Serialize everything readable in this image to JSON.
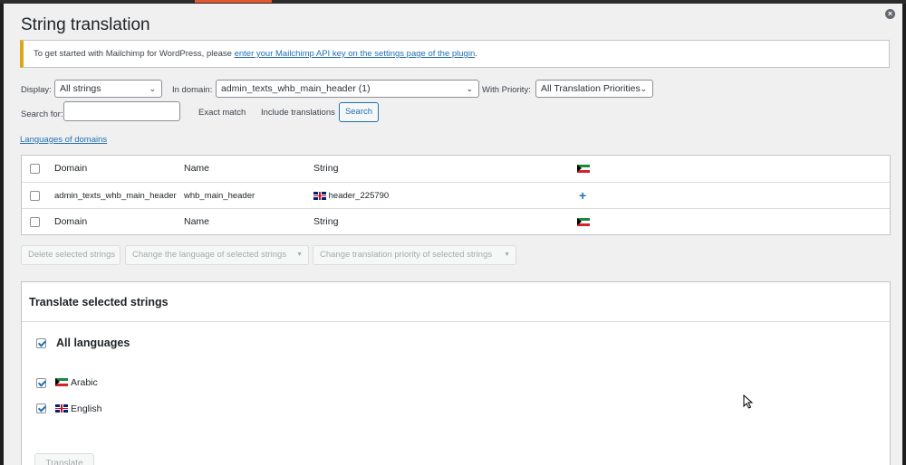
{
  "modal": {
    "title": "String translation"
  },
  "notice": {
    "text": "To get started with Mailchimp for WordPress, please",
    "link": "enter your Mailchimp API key on the settings page of the plugin",
    "end": "."
  },
  "filters": {
    "display_label": "Display:",
    "display_value": "All strings",
    "domain_label": "In domain:",
    "domain_value": "admin_texts_whb_main_header (1)",
    "priority_label": "With Priority:",
    "priority_value": "All Translation Priorities",
    "search_label": "Search for:",
    "search_value": "",
    "exact_match": "Exact match",
    "include_translations": "Include translations",
    "search_button": "Search"
  },
  "languages_link": "Languages of domains",
  "table": {
    "headers": {
      "domain": "Domain",
      "name": "Name",
      "string": "String"
    },
    "rows": [
      {
        "domain": "admin_texts_whb_main_header",
        "name": "whb_main_header",
        "string": "header_225790",
        "action": "+"
      }
    ],
    "footers": {
      "domain": "Domain",
      "name": "Name",
      "string": "String"
    }
  },
  "bulk_actions": {
    "delete": "Delete selected strings",
    "change_language": "Change the language of selected strings",
    "change_priority": "Change translation priority of selected strings"
  },
  "translate_panel": {
    "title": "Translate selected strings",
    "all_languages": "All languages",
    "languages": [
      {
        "label": "Arabic",
        "checked": true,
        "flag": "kuwait-flag-icon"
      },
      {
        "label": "English",
        "checked": true,
        "flag": "uk-flag-icon"
      }
    ],
    "translate_button": "Translate"
  },
  "colors": {
    "accent": "#2271b1",
    "notice_border": "#dba617"
  }
}
